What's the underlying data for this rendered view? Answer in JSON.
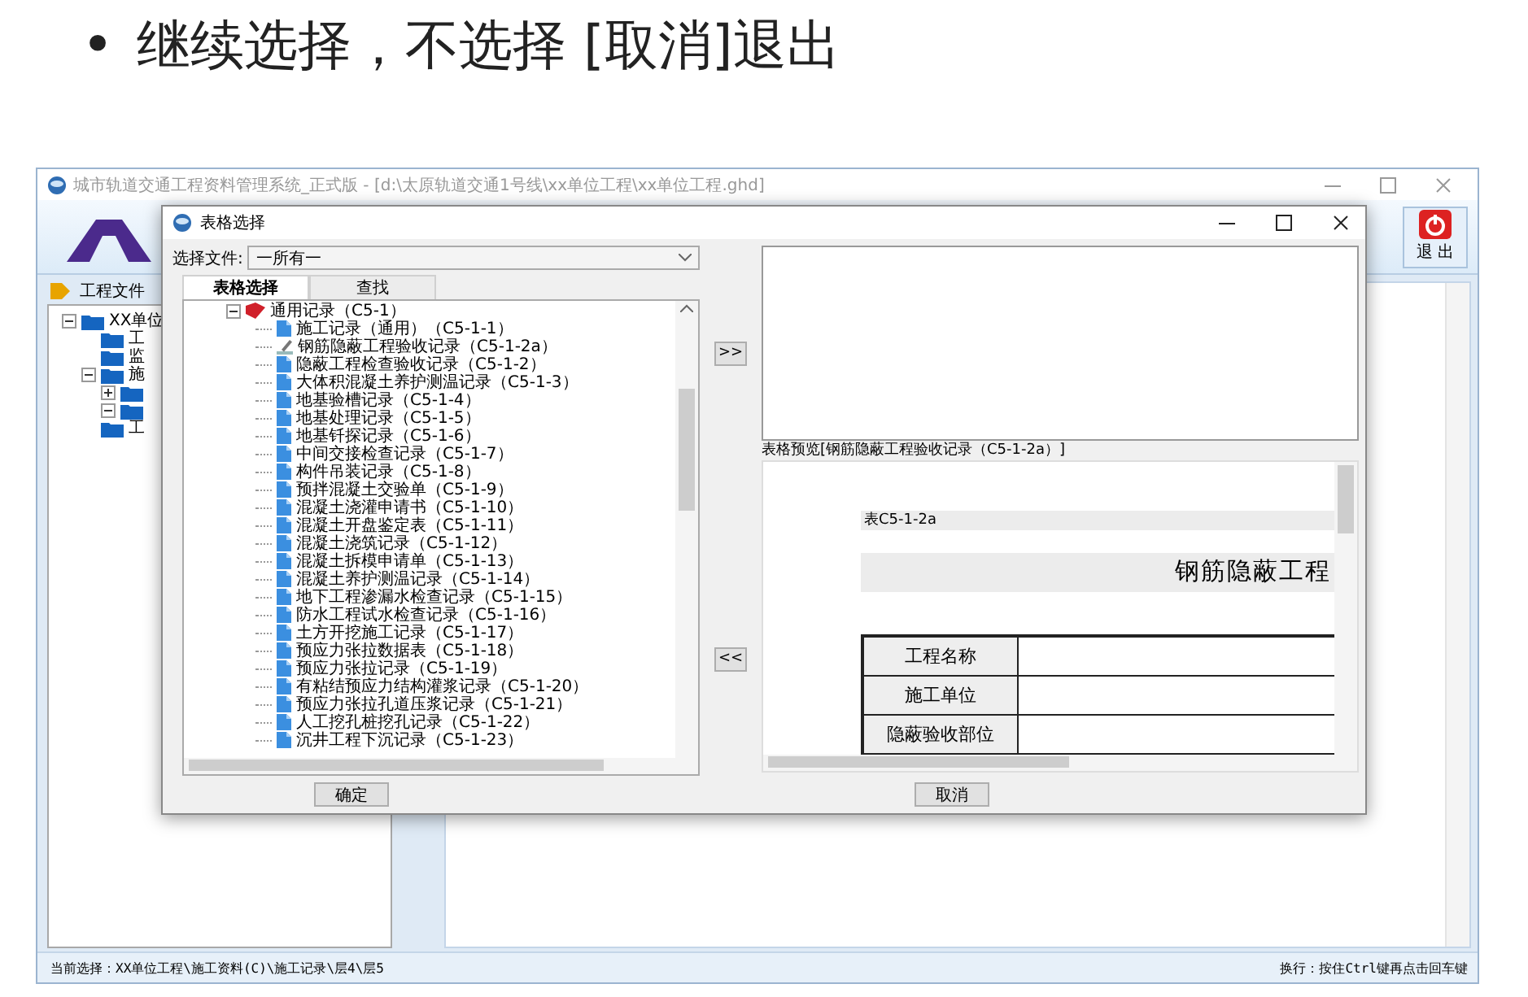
{
  "slide": {
    "bullet": "•",
    "text": "继续选择，不选择 [取消]退出"
  },
  "main_window": {
    "title": "城市轨道交通工程资料管理系统_正式版 - [d:\\太原轨道交通1号线\\xx单位工程\\xx单位工程.ghd]",
    "exit_button": "退 出",
    "sidebar": {
      "header": "工程文件",
      "tree": [
        {
          "label": "XX单位",
          "expanded": true,
          "children": [
            {
              "label": "工"
            },
            {
              "label": "监"
            },
            {
              "label": "施",
              "expanded": true,
              "children": [
                {
                  "expanded": false
                },
                {
                  "expanded": true
                }
              ]
            },
            {
              "label": "工"
            }
          ]
        }
      ]
    },
    "status_left": "当前选择：XX单位工程\\施工资料(C)\\施工记录\\层4\\层5",
    "status_right": "换行：按住Ctrl键再点击回车键"
  },
  "dialog": {
    "title": "表格选择",
    "file_label": "选择文件:",
    "file_value": "一所有一",
    "tabs": [
      {
        "label": "表格选择",
        "selected": true
      },
      {
        "label": "查找",
        "selected": false
      }
    ],
    "tree": [
      {
        "label": "通用记录（C5-1）",
        "expanded": true,
        "children": [
          {
            "label": "施工记录（通用）（C5-1-1）",
            "kind": "doc"
          },
          {
            "label": "钢筋隐蔽工程验收记录（C5-1-2a）",
            "kind": "edit"
          },
          {
            "label": "隐蔽工程检查验收记录（C5-1-2）",
            "kind": "doc"
          },
          {
            "label": "大体积混凝土养护测温记录（C5-1-3）",
            "kind": "doc"
          },
          {
            "label": "地基验槽记录（C5-1-4）",
            "kind": "doc"
          },
          {
            "label": "地基处理记录（C5-1-5）",
            "kind": "doc"
          },
          {
            "label": "地基钎探记录（C5-1-6）",
            "kind": "doc"
          },
          {
            "label": "中间交接检查记录（C5-1-7）",
            "kind": "doc"
          },
          {
            "label": "构件吊装记录（C5-1-8）",
            "kind": "doc"
          },
          {
            "label": "预拌混凝土交验单（C5-1-9）",
            "kind": "doc"
          },
          {
            "label": "混凝土浇灌申请书（C5-1-10）",
            "kind": "doc"
          },
          {
            "label": "混凝土开盘鉴定表（C5-1-11）",
            "kind": "doc"
          },
          {
            "label": "混凝土浇筑记录（C5-1-12）",
            "kind": "doc"
          },
          {
            "label": "混凝土拆模申请单（C5-1-13）",
            "kind": "doc"
          },
          {
            "label": "混凝土养护测温记录（C5-1-14）",
            "kind": "doc"
          },
          {
            "label": "地下工程渗漏水检查记录（C5-1-15）",
            "kind": "doc"
          },
          {
            "label": "防水工程试水检查记录（C5-1-16）",
            "kind": "doc"
          },
          {
            "label": "土方开挖施工记录（C5-1-17）",
            "kind": "doc"
          },
          {
            "label": "预应力张拉数据表（C5-1-18）",
            "kind": "doc"
          },
          {
            "label": "预应力张拉记录（C5-1-19）",
            "kind": "doc"
          },
          {
            "label": "有粘结预应力结构灌浆记录（C5-1-20）",
            "kind": "doc"
          },
          {
            "label": "预应力张拉孔道压浆记录（C5-1-21）",
            "kind": "doc"
          },
          {
            "label": "人工挖孔桩挖孔记录（C5-1-22）",
            "kind": "doc"
          },
          {
            "label": "沉井工程下沉记录（C5-1-23）",
            "kind": "doc"
          }
        ]
      }
    ],
    "add_button": ">>",
    "remove_button": "<<",
    "preview_label": "表格预览[钢筋隐蔽工程验收记录（C5-1-2a）]",
    "preview": {
      "form_code": "表C5-1-2a",
      "form_title": "钢筋隐蔽工程",
      "rows": [
        "工程名称",
        "施工单位",
        "隐蔽验收部位"
      ]
    },
    "ok_button": "确定",
    "cancel_button": "取消"
  }
}
